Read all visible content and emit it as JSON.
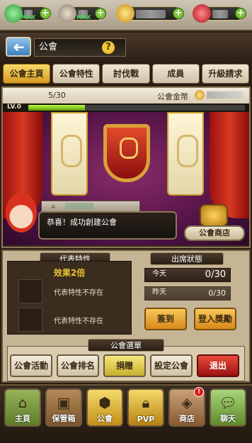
{
  "resources": {
    "max_label_1": "MAX",
    "max_label_2": "MAX",
    "plus": "+"
  },
  "header": {
    "title": "公會",
    "back_glyph": "➜",
    "help_glyph": "?"
  },
  "tabs": [
    {
      "label": "公會主頁",
      "active": true
    },
    {
      "label": "公會特性"
    },
    {
      "label": "討伐戰"
    },
    {
      "label": "成員"
    },
    {
      "label": "升級請求"
    }
  ],
  "guild": {
    "member_count": "5/30",
    "gold_label": "公會金幣",
    "level": "LV.0",
    "welcome_message": "恭喜！成功創建公會",
    "shop_label": "公會商店"
  },
  "traits": {
    "header": "代表特性",
    "effect": "效果2倍",
    "slot1_text": "代表特性不存在",
    "slot2_text": "代表特性不存在"
  },
  "attendance": {
    "header": "出席狀態",
    "today_label": "今天",
    "today_value": "0/30",
    "yesterday_label": "昨天",
    "yesterday_value": "0/30",
    "checkin_label": "簽到",
    "reward_label": "登入獎勵"
  },
  "guild_menu": {
    "header": "公會選單",
    "items": [
      "公會活動",
      "公會排名",
      "捐贈",
      "設定公會",
      "退出"
    ]
  },
  "nav": {
    "items": [
      "主頁",
      "保管箱",
      "公會",
      "PVP",
      "商店",
      "聊天"
    ],
    "shop_badge": "!"
  }
}
